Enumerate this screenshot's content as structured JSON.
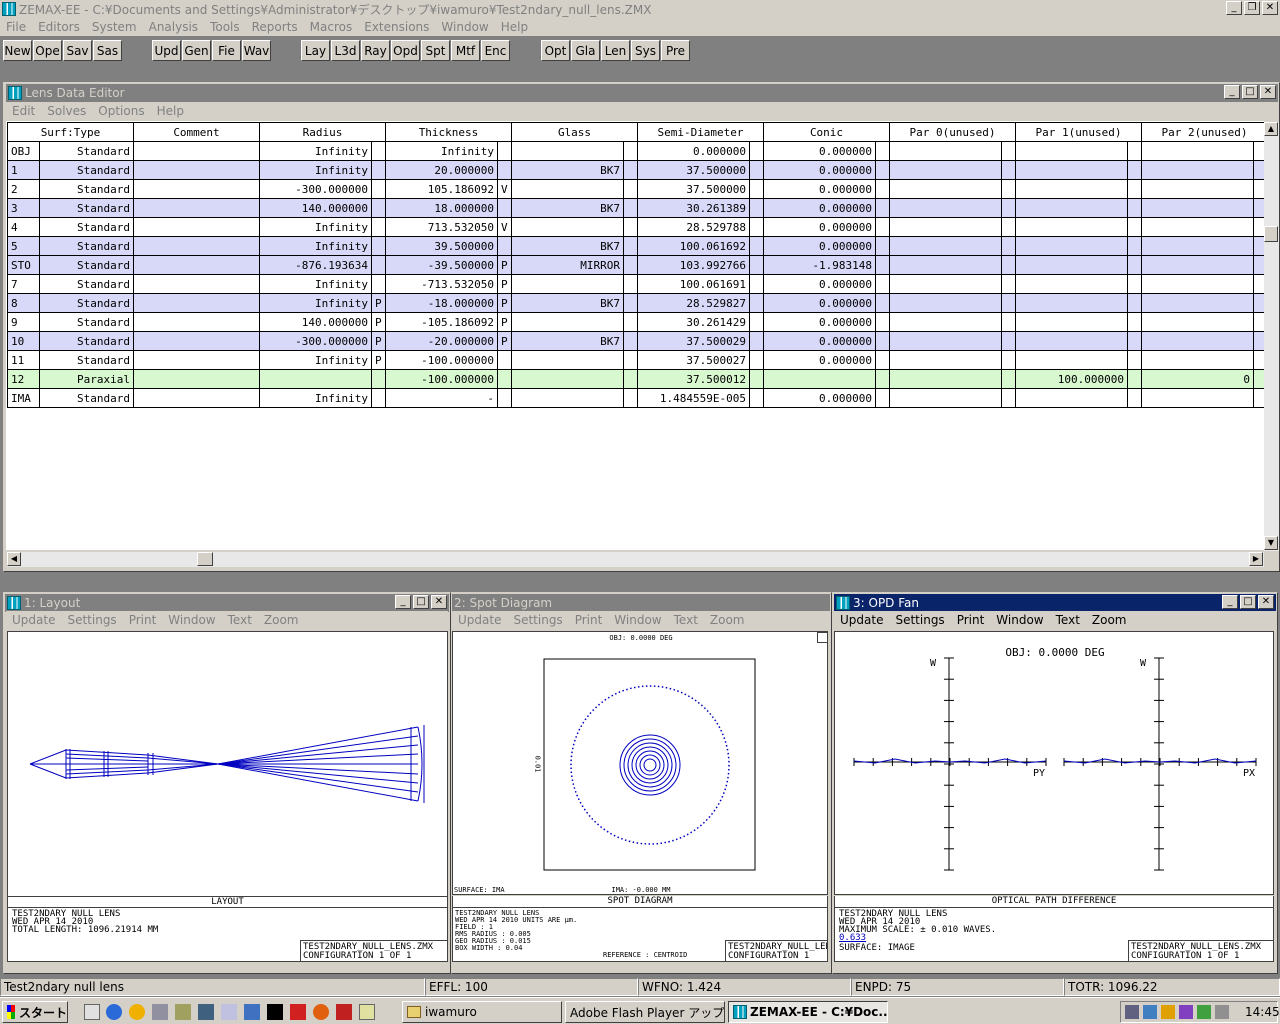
{
  "app": {
    "title": "ZEMAX-EE - C:¥Documents and Settings¥Administrator¥デスクトップ¥iwamuro¥Test2ndary_null_lens.ZMX",
    "menu": [
      "File",
      "Editors",
      "System",
      "Analysis",
      "Tools",
      "Reports",
      "Macros",
      "Extensions",
      "Window",
      "Help"
    ]
  },
  "toolbar": {
    "group1": [
      "New",
      "Ope",
      "Sav",
      "Sas"
    ],
    "group2": [
      "Upd",
      "Gen",
      "Fie",
      "Wav"
    ],
    "group3": [
      "Lay",
      "L3d",
      "Ray",
      "Opd",
      "Spt",
      "Mtf",
      "Enc"
    ],
    "group4": [
      "Opt",
      "Gla",
      "Len",
      "Sys",
      "Pre"
    ]
  },
  "lde": {
    "title": "Lens Data Editor",
    "menu": [
      "Edit",
      "Solves",
      "Options",
      "Help"
    ],
    "headers": [
      "Surf:Type",
      "Comment",
      "Radius",
      "Thickness",
      "Glass",
      "Semi-Diameter",
      "Conic",
      "Par 0(unused)",
      "Par 1(unused)",
      "Par 2(unused)"
    ],
    "rows": [
      {
        "surf": "OBJ",
        "type": "Standard",
        "comment": "",
        "radius": "Infinity",
        "rs": "",
        "thickness": "Infinity",
        "ts": "",
        "glass": "",
        "semi": "0.000000",
        "conic": "0.000000",
        "p0": "",
        "p1": "",
        "p2": "",
        "style": "white"
      },
      {
        "surf": "1",
        "type": "Standard",
        "comment": "",
        "radius": "Infinity",
        "rs": "",
        "thickness": "20.000000",
        "ts": "",
        "glass": "BK7",
        "semi": "37.500000",
        "conic": "0.000000",
        "p0": "",
        "p1": "",
        "p2": "",
        "style": "purple"
      },
      {
        "surf": "2",
        "type": "Standard",
        "comment": "",
        "radius": "-300.000000",
        "rs": "",
        "thickness": "105.186092",
        "ts": "V",
        "glass": "",
        "semi": "37.500000",
        "conic": "0.000000",
        "p0": "",
        "p1": "",
        "p2": "",
        "style": "white"
      },
      {
        "surf": "3",
        "type": "Standard",
        "comment": "",
        "radius": "140.000000",
        "rs": "",
        "thickness": "18.000000",
        "ts": "",
        "glass": "BK7",
        "semi": "30.261389",
        "conic": "0.000000",
        "p0": "",
        "p1": "",
        "p2": "",
        "style": "purple"
      },
      {
        "surf": "4",
        "type": "Standard",
        "comment": "",
        "radius": "Infinity",
        "rs": "",
        "thickness": "713.532050",
        "ts": "V",
        "glass": "",
        "semi": "28.529788",
        "conic": "0.000000",
        "p0": "",
        "p1": "",
        "p2": "",
        "style": "white"
      },
      {
        "surf": "5",
        "type": "Standard",
        "comment": "",
        "radius": "Infinity",
        "rs": "",
        "thickness": "39.500000",
        "ts": "",
        "glass": "BK7",
        "semi": "100.061692",
        "conic": "0.000000",
        "p0": "",
        "p1": "",
        "p2": "",
        "style": "purple"
      },
      {
        "surf": "STO",
        "type": "Standard",
        "comment": "",
        "radius": "-876.193634",
        "rs": "",
        "thickness": "-39.500000",
        "ts": "P",
        "glass": "MIRROR",
        "semi": "103.992766",
        "conic": "-1.983148",
        "p0": "",
        "p1": "",
        "p2": "",
        "style": "purple"
      },
      {
        "surf": "7",
        "type": "Standard",
        "comment": "",
        "radius": "Infinity",
        "rs": "",
        "thickness": "-713.532050",
        "ts": "P",
        "glass": "",
        "semi": "100.061691",
        "conic": "0.000000",
        "p0": "",
        "p1": "",
        "p2": "",
        "style": "white"
      },
      {
        "surf": "8",
        "type": "Standard",
        "comment": "",
        "radius": "Infinity",
        "rs": "P",
        "thickness": "-18.000000",
        "ts": "P",
        "glass": "BK7",
        "semi": "28.529827",
        "conic": "0.000000",
        "p0": "",
        "p1": "",
        "p2": "",
        "style": "purple"
      },
      {
        "surf": "9",
        "type": "Standard",
        "comment": "",
        "radius": "140.000000",
        "rs": "P",
        "thickness": "-105.186092",
        "ts": "P",
        "glass": "",
        "semi": "30.261429",
        "conic": "0.000000",
        "p0": "",
        "p1": "",
        "p2": "",
        "style": "white"
      },
      {
        "surf": "10",
        "type": "Standard",
        "comment": "",
        "radius": "-300.000000",
        "rs": "P",
        "thickness": "-20.000000",
        "ts": "P",
        "glass": "BK7",
        "semi": "37.500029",
        "conic": "0.000000",
        "p0": "",
        "p1": "",
        "p2": "",
        "style": "purple"
      },
      {
        "surf": "11",
        "type": "Standard",
        "comment": "",
        "radius": "Infinity",
        "rs": "P",
        "thickness": "-100.000000",
        "ts": "",
        "glass": "",
        "semi": "37.500027",
        "conic": "0.000000",
        "p0": "",
        "p1": "",
        "p2": "",
        "style": "white"
      },
      {
        "surf": "12",
        "type": "Paraxial",
        "comment": "",
        "radius": "",
        "rs": "",
        "thickness": "-100.000000",
        "ts": "",
        "glass": "",
        "semi": "37.500012",
        "conic": "",
        "p0": "",
        "p1": "100.000000",
        "p2": "0",
        "style": "green"
      },
      {
        "surf": "IMA",
        "type": "Standard",
        "comment": "",
        "radius": "Infinity",
        "rs": "",
        "thickness": "-",
        "ts": "",
        "glass": "",
        "semi": "1.484559E-005",
        "conic": "0.000000",
        "p0": "",
        "p1": "",
        "p2": "",
        "style": "white"
      }
    ]
  },
  "layout": {
    "title": "1: Layout",
    "menu": [
      "Update",
      "Settings",
      "Print",
      "Window",
      "Text",
      "Zoom"
    ],
    "caption": "LAYOUT",
    "info": [
      "TEST2NDARY NULL LENS",
      "WED APR 14 2010",
      "TOTAL LENGTH: 1096.21914 MM"
    ],
    "file": [
      "TEST2NDARY_NULL_LENS.ZMX",
      "CONFIGURATION  1  OF  1"
    ]
  },
  "spot": {
    "title": "2: Spot Diagram",
    "menu": [
      "Update",
      "Settings",
      "Print",
      "Window",
      "Text",
      "Zoom"
    ],
    "obj": "OBJ: 0.0000 DEG",
    "ima": "IMA: -0.000 MM",
    "surface": "SURFACE: IMA",
    "side": "0.01",
    "caption": "SPOT DIAGRAM",
    "info": [
      "TEST2NDARY NULL LENS",
      "WED APR 14 2010   UNITS ARE µm.",
      "FIELD  :          1",
      "RMS RADIUS :      0.005",
      "GEO RADIUS :      0.015",
      "BOX WIDTH  :      0.04",
      "REFERENCE  : CENTROID"
    ],
    "file": [
      "TEST2NDARY_NULL_LENS.ZMX",
      "CONFIGURATION  1"
    ]
  },
  "opd": {
    "title": "3: OPD Fan",
    "menu": [
      "Update",
      "Settings",
      "Print",
      "Window",
      "Text",
      "Zoom"
    ],
    "obj": "OBJ: 0.0000 DEG",
    "axis_w": "W",
    "axis_py": "PY",
    "axis_px": "PX",
    "caption": "OPTICAL PATH DIFFERENCE",
    "info": [
      "TEST2NDARY NULL LENS",
      "WED APR 14 2010",
      "MAXIMUM SCALE: ± 0.010 WAVES.",
      "0.633",
      "SURFACE: IMAGE"
    ],
    "file": [
      "TEST2NDARY_NULL_LENS.ZMX",
      "CONFIGURATION  1  OF  1"
    ]
  },
  "status": {
    "name": "Test2ndary null lens",
    "effl": "EFFL: 100",
    "wfno": "WFNO: 1.424",
    "enpd": "ENPD: 75",
    "totr": "TOTR: 1096.22"
  },
  "taskbar": {
    "start": "スタート",
    "tasks": [
      "iwamuro",
      "Adobe Flash Player アップデ...",
      "ZEMAX-EE - C:¥Doc..."
    ],
    "clock": "14:45"
  },
  "colors": {
    "titlebar_active": "#0a246a",
    "desktop": "#808080",
    "row_purple": "#d8d8f8",
    "row_green": "#d8f8d0",
    "plot": "#0000c0"
  }
}
